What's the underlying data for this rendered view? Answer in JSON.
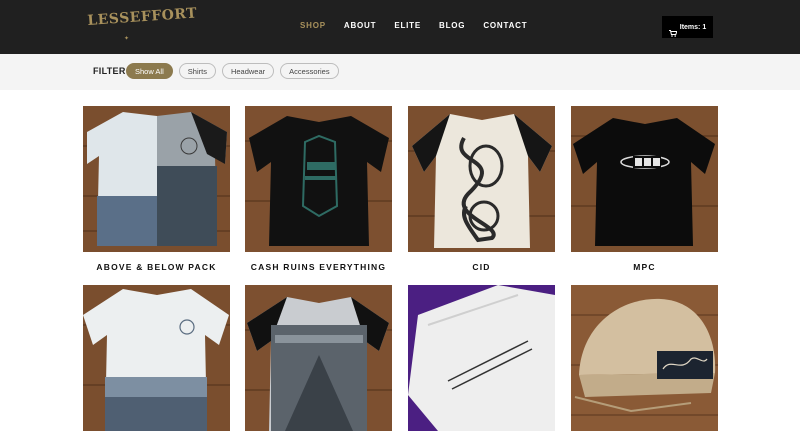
{
  "brand": {
    "logo_text": "LESSEFFORT",
    "accent_color": "#a8915c"
  },
  "nav": {
    "items": [
      {
        "label": "SHOP",
        "active": true
      },
      {
        "label": "ABOUT",
        "active": false
      },
      {
        "label": "ELITE",
        "active": false
      },
      {
        "label": "BLOG",
        "active": false
      },
      {
        "label": "CONTACT",
        "active": false
      }
    ]
  },
  "cart": {
    "label": "Items: 1",
    "icon": "cart-icon"
  },
  "filter": {
    "label": "FILTER",
    "options": [
      {
        "label": "Show All",
        "active": true
      },
      {
        "label": "Shirts",
        "active": false
      },
      {
        "label": "Headwear",
        "active": false
      },
      {
        "label": "Accessories",
        "active": false
      }
    ]
  },
  "products": [
    {
      "title": "ABOVE & BELOW PACK"
    },
    {
      "title": "CASH RUINS EVERYTHING"
    },
    {
      "title": "CID"
    },
    {
      "title": "MPC"
    },
    {
      "title": ""
    },
    {
      "title": ""
    },
    {
      "title": ""
    },
    {
      "title": ""
    }
  ],
  "colors": {
    "header_bg": "#202020",
    "filter_bg": "#f4f4f4",
    "active_chip": "#8c7a4e",
    "wood": "#8a5a36"
  }
}
